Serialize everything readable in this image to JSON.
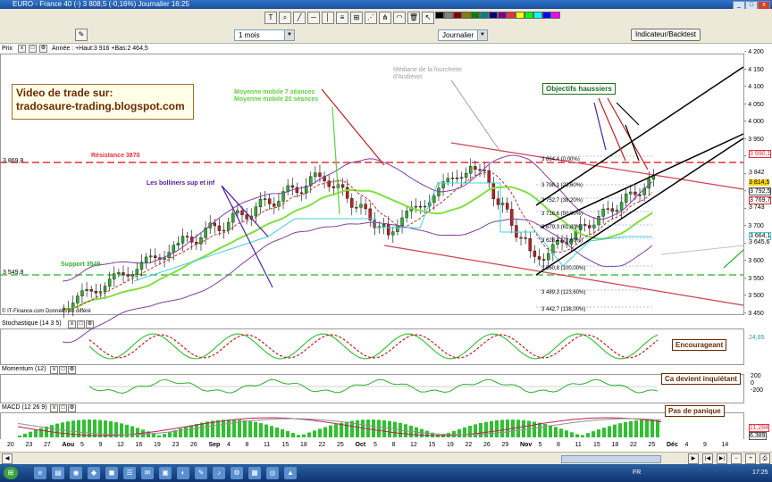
{
  "window": {
    "title": "EURO - France 40 (-)    3 808,5 (-0,16%)    Journalier  16:25",
    "min": "_",
    "max": "□",
    "close": "x"
  },
  "controls": {
    "period": "1 mois",
    "interval": "Journalier",
    "indicator_button": "Indicateur/Backtest"
  },
  "price_panel": {
    "label": "Prix",
    "stats": "Année : +Haut:3 916  +Bas:2 464,5",
    "copyright": "© IT-Finance.com  Données en différé",
    "promo_line1": "Video de trade sur:",
    "promo_line2": "tradosaure-trading.blogspot.com",
    "y_ticks": [
      "4 200",
      "4 150",
      "4 100",
      "4 050",
      "4 000",
      "3 950",
      "3 900",
      "3 850",
      "3 800",
      "3 750",
      "3 700",
      "3 650",
      "3 600",
      "3 550",
      "3 500",
      "3 450"
    ],
    "price_boxes": [
      "3 990,1",
      "3 842",
      "3 814,5",
      "3 792,5",
      "3 769,7",
      "3 743",
      "3 664,1",
      "3 645,6"
    ],
    "left_levels": [
      "3 869,8",
      "3 549,8"
    ],
    "annotations": {
      "resistance": "Résistance 3870",
      "support": "Support 3549",
      "ma": "Moyenne mobile 7 séances\nMoyenne mobile 20 séances",
      "bollinger": "Les bolliners sup et inf",
      "mediane": "Médiane de la fourchette\nd'Andrews",
      "objectifs": "Objectifs haussiers"
    },
    "fib_labels": [
      "3 864,4 (0,00%)",
      "3 798,1 (23,60%)",
      "3 752,7 (38,20%)",
      "3 716,6 (50,00%)",
      "3 679,3 (61,80%)",
      "3 628,4 (78,60%)",
      "3 560,8 (100,00%)",
      "3 489,3 (123,60%)",
      "3 442,7 (138,00%)"
    ]
  },
  "stochastic": {
    "label": "Stochastique (14 3 5)",
    "note": "Encourageant",
    "value": "24,85"
  },
  "momentum": {
    "label": "Momentum (12)",
    "note": "Ca devient inquiétant",
    "ticks": [
      "200",
      "0",
      "-200"
    ]
  },
  "macd": {
    "label": "MACD (12 26 9)",
    "note": "Pas de panique",
    "values": [
      "11,284",
      "6,389"
    ]
  },
  "x_axis": [
    "20",
    "23",
    "27",
    "Aou",
    "5",
    "9",
    "12",
    "16",
    "19",
    "23",
    "26",
    "Sep",
    "4",
    "8",
    "11",
    "15",
    "18",
    "22",
    "25",
    "Oct",
    "5",
    "8",
    "12",
    "15",
    "19",
    "22",
    "26",
    "29",
    "Nov",
    "5",
    "8",
    "11",
    "15",
    "18",
    "22",
    "25",
    "Déc",
    "4",
    "9",
    "14"
  ],
  "taskbar": {
    "lang": "FR",
    "clock": "17:25"
  },
  "colors": {
    "resistance": "#e8303a",
    "support": "#48c048",
    "ma7": "#c03030",
    "ma20": "#80e040",
    "bollinger": "#8040a0",
    "title_bar": "#1b4f9c"
  }
}
